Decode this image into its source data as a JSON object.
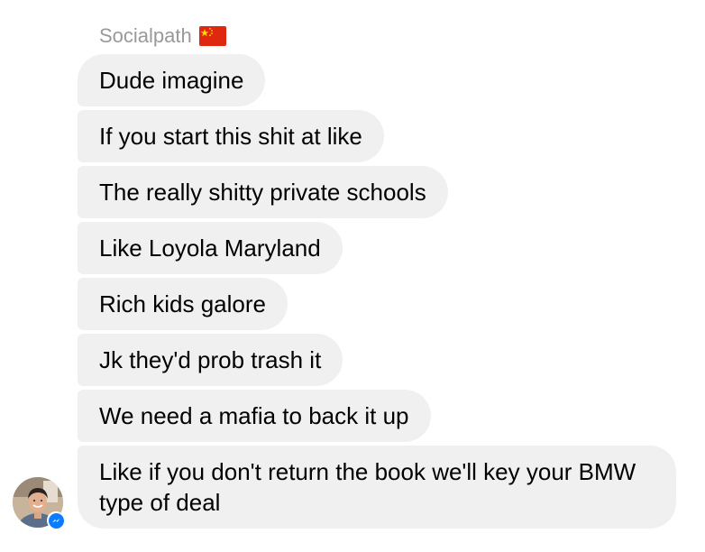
{
  "conversation": {
    "sender_name": "Socialpath",
    "sender_flag_icon": "china-flag-icon",
    "messages": [
      "Dude imagine",
      "If you start this shit at like",
      "The really shitty private schools",
      "Like Loyola Maryland",
      "Rich kids galore",
      "Jk they'd prob trash it",
      "We need a mafia to back it up",
      "Like if you don't return the book we'll key your BMW type of deal"
    ],
    "bubble_color": "#f1f0f0",
    "messenger_badge_color": "#0a7cff"
  }
}
